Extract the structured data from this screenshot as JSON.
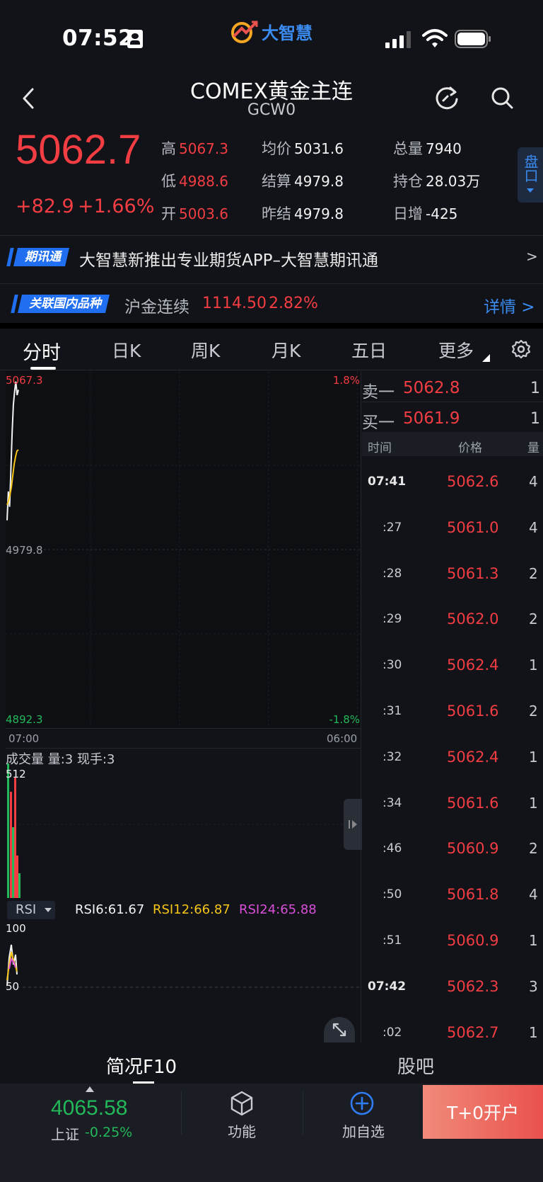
{
  "status": {
    "time": "07:52"
  },
  "app": {
    "logo_text": "大智慧"
  },
  "header": {
    "title": "COMEX黄金主连",
    "code": "GCW0"
  },
  "quote": {
    "last": "5062.7",
    "change": "+82.9",
    "change_pct": "+1.66%",
    "fields": [
      {
        "label": "高",
        "value": "5067.3",
        "color": "#f23d43"
      },
      {
        "label": "均价",
        "value": "5031.6",
        "color": "#f2f2f2"
      },
      {
        "label": "总量",
        "value": "7940",
        "color": "#f2f2f2"
      },
      {
        "label": "低",
        "value": "4988.6",
        "color": "#f23d43"
      },
      {
        "label": "结算",
        "value": "4979.8",
        "color": "#f2f2f2"
      },
      {
        "label": "持仓",
        "value": "28.03万",
        "color": "#f2f2f2"
      },
      {
        "label": "开",
        "value": "5003.6",
        "color": "#f23d43"
      },
      {
        "label": "昨结",
        "value": "4979.8",
        "color": "#f2f2f2"
      },
      {
        "label": "日增",
        "value": "-425",
        "color": "#f2f2f2"
      }
    ],
    "side_tab": "盘口"
  },
  "news": {
    "tag": "期讯通",
    "text": "大智慧新推出专业期货APP–大智慧期讯通",
    "arrow": ">"
  },
  "related": {
    "tag": "关联国内品种",
    "name": "沪金连续",
    "price": "1114.50",
    "pct": "2.82%",
    "detail": "详情 >"
  },
  "tabs": [
    "分时",
    "日K",
    "周K",
    "月K",
    "五日",
    "更多"
  ],
  "chart": {
    "top_price": "5067.3",
    "top_pct": "1.8%",
    "mid_price": "4979.8",
    "bottom_price": "4892.3",
    "bottom_pct": "-1.8%",
    "time_start": "07:00",
    "time_end": "06:00",
    "volume_title": "成交量  量:3  现手:3",
    "volume_max": "512",
    "rsi_selector": "RSI",
    "rsi6": "RSI6:61.67",
    "rsi12": "RSI12:66.87",
    "rsi24": "RSI24:65.88",
    "rsi_top": "100",
    "rsi_mid": "50"
  },
  "chart_data": {
    "type": "line",
    "title": "",
    "ylim": [
      4892.3,
      5067.3
    ],
    "series": [
      {
        "values": [
          4995,
          5010,
          5002,
          5020,
          5040,
          5055,
          5062,
          5067,
          5060,
          5062.7
        ]
      },
      {
        "values": [
          5003,
          5005,
          5008,
          5012,
          5018,
          5024,
          5028,
          5031,
          5031.6
        ]
      }
    ]
  },
  "orderbook": {
    "ask_label": "卖一",
    "ask_price": "5062.8",
    "ask_qty": "1",
    "bid_label": "买一",
    "bid_price": "5061.9",
    "bid_qty": "1",
    "header": {
      "time": "时间",
      "price": "价格",
      "qty": "量"
    },
    "ticks": [
      {
        "time": "07:41",
        "price": "5062.6",
        "qty": "4"
      },
      {
        "time": ":27",
        "price": "5061.0",
        "qty": "4"
      },
      {
        "time": ":28",
        "price": "5061.3",
        "qty": "2"
      },
      {
        "time": ":29",
        "price": "5062.0",
        "qty": "2"
      },
      {
        "time": ":30",
        "price": "5062.4",
        "qty": "1"
      },
      {
        "time": ":31",
        "price": "5061.6",
        "qty": "2"
      },
      {
        "time": ":32",
        "price": "5062.4",
        "qty": "1"
      },
      {
        "time": ":34",
        "price": "5061.6",
        "qty": "1"
      },
      {
        "time": ":46",
        "price": "5060.9",
        "qty": "2"
      },
      {
        "time": ":50",
        "price": "5061.8",
        "qty": "4"
      },
      {
        "time": ":51",
        "price": "5060.9",
        "qty": "1"
      },
      {
        "time": "07:42",
        "price": "5062.3",
        "qty": "3"
      },
      {
        "time": ":02",
        "price": "5062.7",
        "qty": "1"
      }
    ]
  },
  "bottom_tabs": [
    "简况F10",
    "股吧"
  ],
  "bottom_bar": {
    "index_value": "4065.58",
    "index_name": "上证",
    "index_pct": "-0.25%",
    "func_label": "功能",
    "add_label": "加自选",
    "open_label": "T+0开户"
  }
}
